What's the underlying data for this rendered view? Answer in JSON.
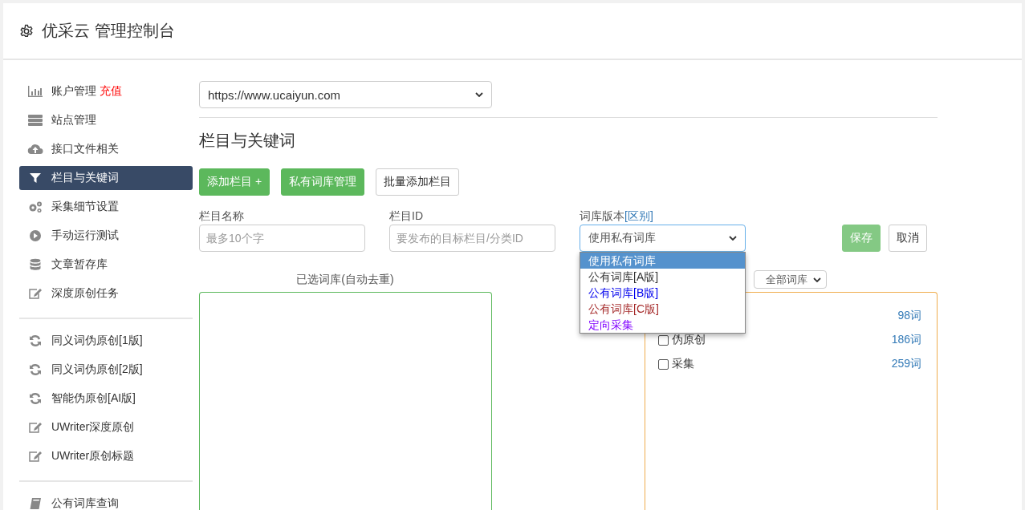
{
  "header": {
    "title": "优采云 管理控制台"
  },
  "sidebar": {
    "groups": [
      {
        "items": [
          {
            "label": "账户管理",
            "badge": "充值",
            "selected": false
          },
          {
            "label": "站点管理",
            "selected": false
          },
          {
            "label": "接口文件相关",
            "selected": false
          },
          {
            "label": "栏目与关键词",
            "selected": true
          },
          {
            "label": "采集细节设置",
            "selected": false
          },
          {
            "label": "手动运行测试",
            "selected": false
          },
          {
            "label": "文章暂存库",
            "selected": false
          },
          {
            "label": "深度原创任务",
            "selected": false
          }
        ]
      },
      {
        "items": [
          {
            "label": "同义词伪原创[1版]",
            "selected": false
          },
          {
            "label": "同义词伪原创[2版]",
            "selected": false
          },
          {
            "label": "智能伪原创[AI版]",
            "selected": false
          },
          {
            "label": "UWriter深度原创",
            "selected": false
          },
          {
            "label": "UWriter原创标题",
            "selected": false
          }
        ]
      },
      {
        "items": [
          {
            "label": "公有词库查询",
            "selected": false
          }
        ]
      }
    ]
  },
  "main": {
    "site_select": {
      "value": "https://www.ucaiyun.com"
    },
    "heading": "栏目与关键词",
    "buttons": [
      {
        "label": "添加栏目 +",
        "kind": "primary"
      },
      {
        "label": "私有词库管理",
        "kind": "primary"
      },
      {
        "label": "批量添加栏目",
        "kind": "default"
      }
    ],
    "form": {
      "name_label": "栏目名称",
      "name_placeholder": "最多10个字",
      "id_label": "栏目ID",
      "id_placeholder": "要发布的目标栏目/分类ID",
      "version_label": "词库版本",
      "version_link": "[区别]",
      "version_value": "使用私有词库",
      "version_options": [
        {
          "label": "使用私有词库",
          "selected": true
        },
        {
          "label": "公有词库[A版]",
          "selected": false,
          "color": "#333333"
        },
        {
          "label": "公有词库[B版]",
          "selected": false,
          "color": "#0000ee"
        },
        {
          "label": "公有词库[C版]",
          "selected": false,
          "color": "#a52a2a"
        },
        {
          "label": "定向采集",
          "selected": false,
          "color": "#8000ff"
        }
      ],
      "save": "保存",
      "cancel": "取消"
    },
    "selected_title": "已选词库(自动去重)",
    "library_filter": "全部词库",
    "libraries": [
      {
        "count": "98词"
      },
      {
        "label": "伪原创",
        "count": "186词",
        "checked": false
      },
      {
        "label": "采集",
        "count": "259词",
        "checked": false
      }
    ]
  }
}
